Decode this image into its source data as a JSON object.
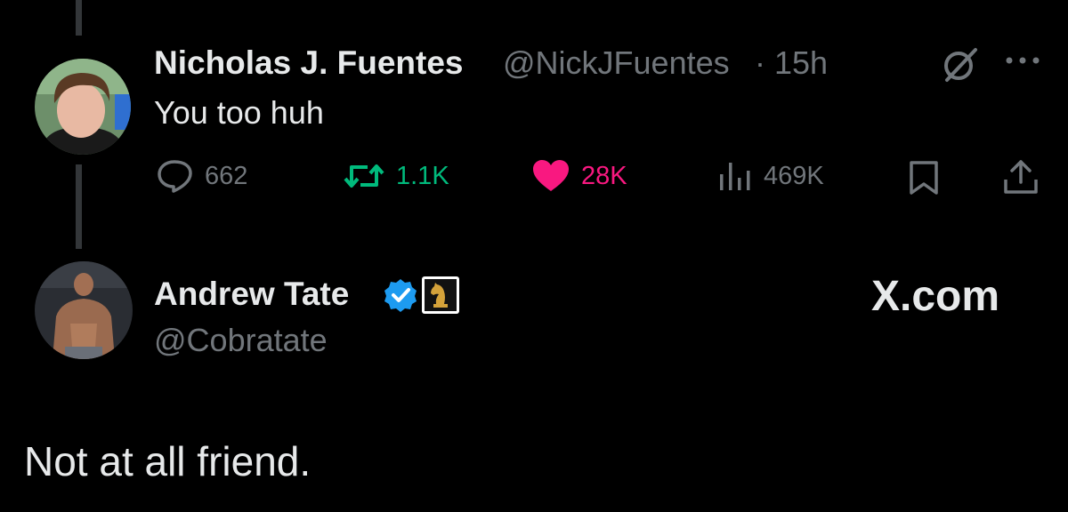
{
  "reply_tweet": {
    "author_name": "Nicholas J. Fuentes",
    "author_handle": "@NickJFuentes",
    "separator": "·",
    "time": "15h",
    "text": "You too huh",
    "stats": {
      "replies": "662",
      "reposts": "1.1K",
      "likes": "28K",
      "views": "469K"
    },
    "icons": [
      "grok-icon",
      "more-icon",
      "reply-icon",
      "repost-icon",
      "like-icon",
      "views-icon",
      "bookmark-icon",
      "share-icon"
    ]
  },
  "main_tweet": {
    "author_name": "Andrew Tate",
    "author_handle": "@Cobratate",
    "verified": true,
    "badge_icon": "chess-knight-icon",
    "brand": "X.com",
    "text": "Not at all friend."
  },
  "colors": {
    "background": "#000000",
    "text_primary": "#e7e9ea",
    "text_secondary": "#71767b",
    "repost_green": "#00ba7c",
    "like_pink": "#f91880",
    "verified_blue": "#1d9bf0"
  }
}
